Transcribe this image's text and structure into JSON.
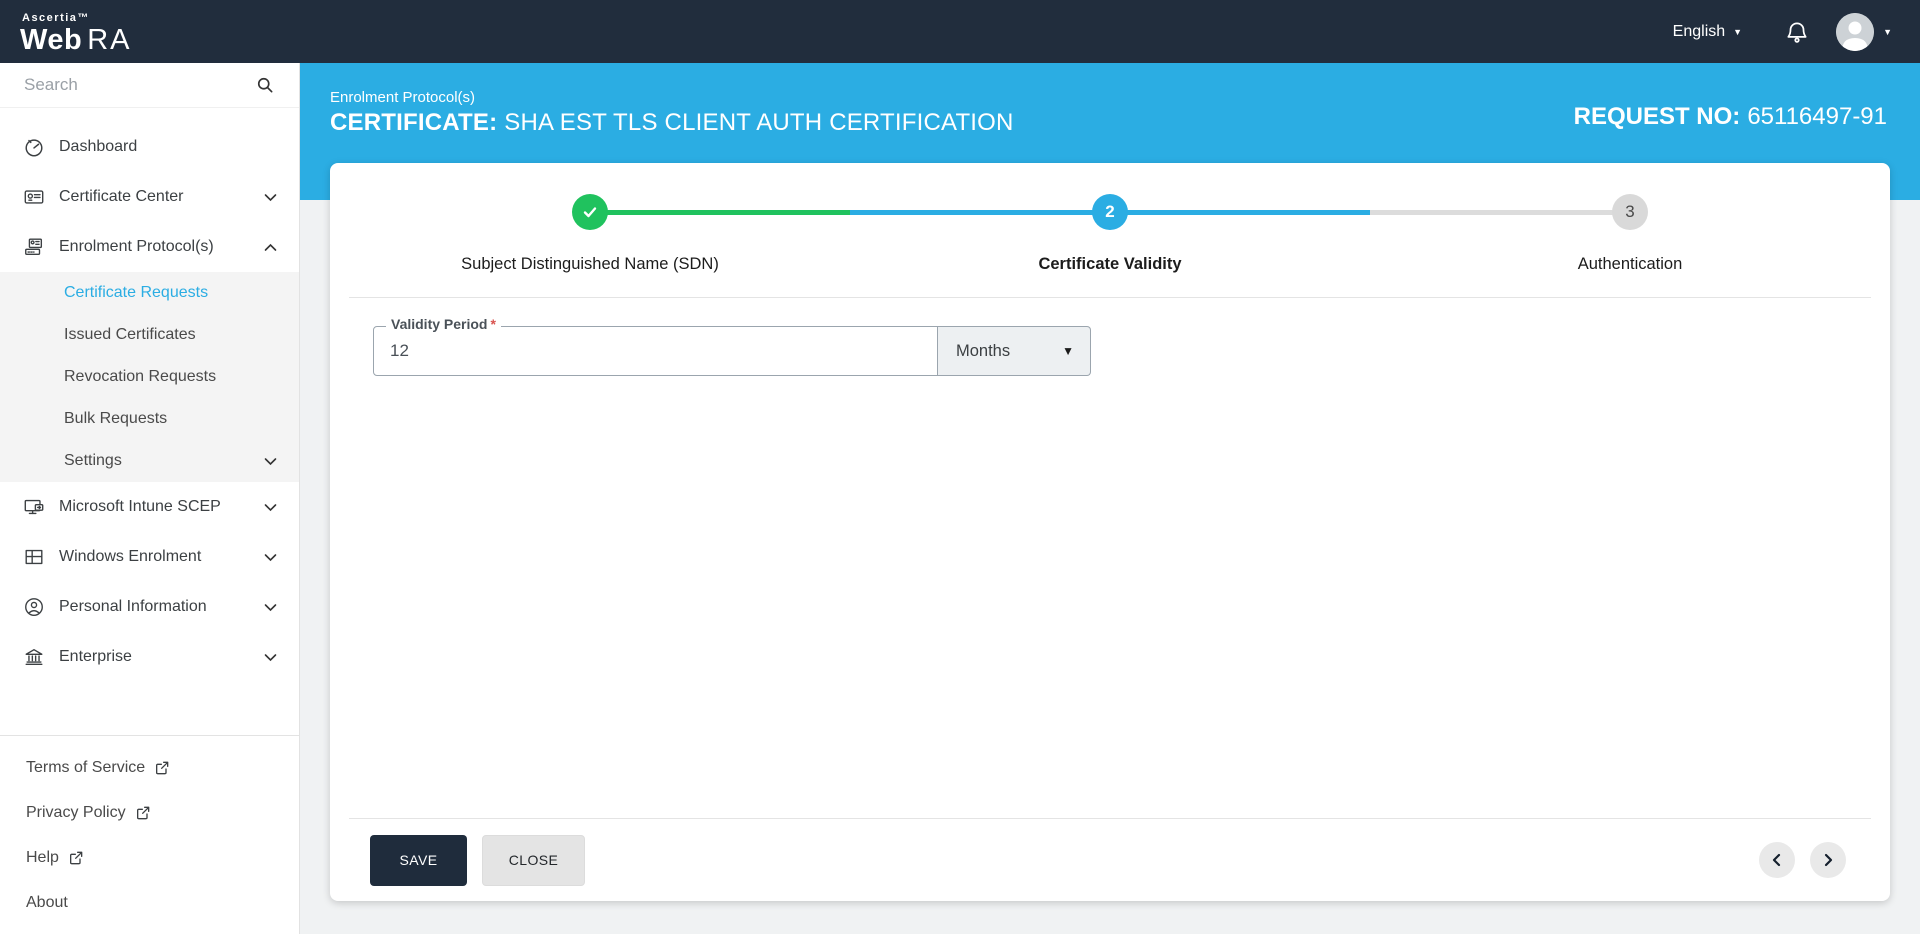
{
  "topbar": {
    "brand_small": "Ascertia™",
    "brand_web": "Web",
    "brand_ra": "RA",
    "language_label": "English"
  },
  "sidebar": {
    "search_placeholder": "Search",
    "items": [
      {
        "label": "Dashboard"
      },
      {
        "label": "Certificate Center"
      },
      {
        "label": "Enrolment Protocol(s)"
      },
      {
        "label": "Microsoft Intune SCEP"
      },
      {
        "label": "Windows Enrolment"
      },
      {
        "label": "Personal Information"
      },
      {
        "label": "Enterprise"
      }
    ],
    "enrolment_submenu": [
      {
        "label": "Certificate Requests",
        "active": true
      },
      {
        "label": "Issued Certificates"
      },
      {
        "label": "Revocation Requests"
      },
      {
        "label": "Bulk Requests"
      },
      {
        "label": "Settings"
      }
    ],
    "footer_links": [
      {
        "label": "Terms of Service"
      },
      {
        "label": "Privacy Policy"
      },
      {
        "label": "Help"
      },
      {
        "label": "About"
      }
    ]
  },
  "header": {
    "breadcrumb": "Enrolment Protocol(s)",
    "title_prefix": "CERTIFICATE:",
    "title": "SHA EST TLS CLIENT AUTH CERTIFICATION",
    "request_label": "REQUEST NO:",
    "request_no": "65116497-91"
  },
  "stepper": {
    "steps": [
      {
        "label": "Subject Distinguished Name (SDN)",
        "state": "done"
      },
      {
        "label": "Certificate Validity",
        "state": "active",
        "number": "2"
      },
      {
        "label": "Authentication",
        "state": "pending",
        "number": "3"
      }
    ]
  },
  "form": {
    "validity_label": "Validity Period",
    "required_mark": "*",
    "validity_value": "12",
    "unit_value": "Months",
    "unit_caret": "▼"
  },
  "footer": {
    "save_label": "SAVE",
    "close_label": "CLOSE"
  },
  "colors": {
    "topbar_bg": "#212d3d",
    "accent_blue": "#2badE3",
    "done_green": "#20c25e",
    "pending_gray": "#d9d9d9",
    "active_link": "#2badE3",
    "save_bg": "#1f2c3c"
  }
}
